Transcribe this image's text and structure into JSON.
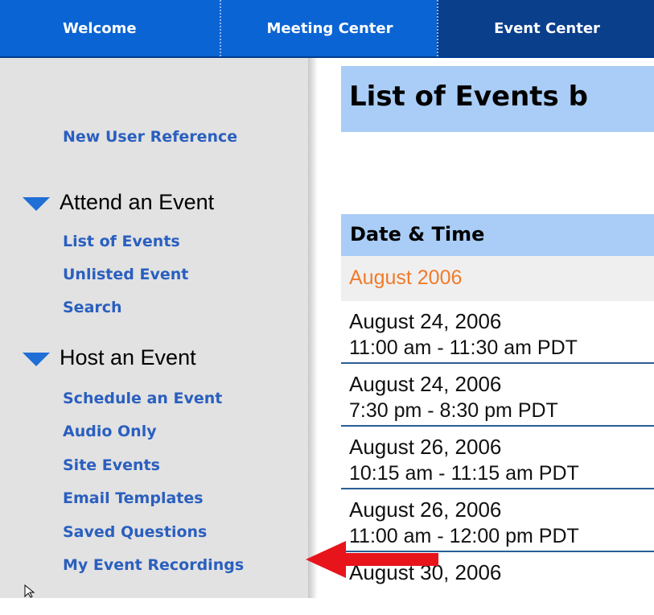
{
  "topnav": {
    "tabs": [
      {
        "label": "Welcome"
      },
      {
        "label": "Meeting Center"
      },
      {
        "label": "Event Center"
      }
    ],
    "colors": {
      "bar": "#0b64d3",
      "active": "#0a3f8c"
    }
  },
  "sidebar": {
    "new_user_reference": "New User Reference",
    "attend": {
      "label": "Attend an Event",
      "links": [
        "List of Events",
        "Unlisted Event",
        "Search"
      ]
    },
    "host": {
      "label": "Host an Event",
      "links": [
        "Schedule an Event",
        "Audio Only",
        "Site Events",
        "Email Templates",
        "Saved Questions",
        "My Event Recordings"
      ]
    },
    "icons": {
      "section_toggle": "triangle-down-icon"
    },
    "colors": {
      "link": "#2a5fbf",
      "background": "#e2e2e2"
    }
  },
  "main": {
    "title": "List of Events b",
    "column_header": "Date & Time",
    "month": "August 2006",
    "events": [
      {
        "date": "August 24, 2006",
        "time": "11:00 am - 11:30 am PDT"
      },
      {
        "date": "August 24, 2006",
        "time": "7:30 pm - 8:30 pm PDT"
      },
      {
        "date": "August 26, 2006",
        "time": "10:15 am - 11:15 am PDT"
      },
      {
        "date": "August 26, 2006",
        "time": "11:00 am - 12:00 pm PDT"
      },
      {
        "date": "August 30, 2006",
        "time": ""
      }
    ],
    "colors": {
      "header": "#a9cdf6",
      "month": "#f07b2a"
    }
  },
  "annotation": {
    "icon": "red-arrow-icon",
    "color": "#e8141b"
  }
}
